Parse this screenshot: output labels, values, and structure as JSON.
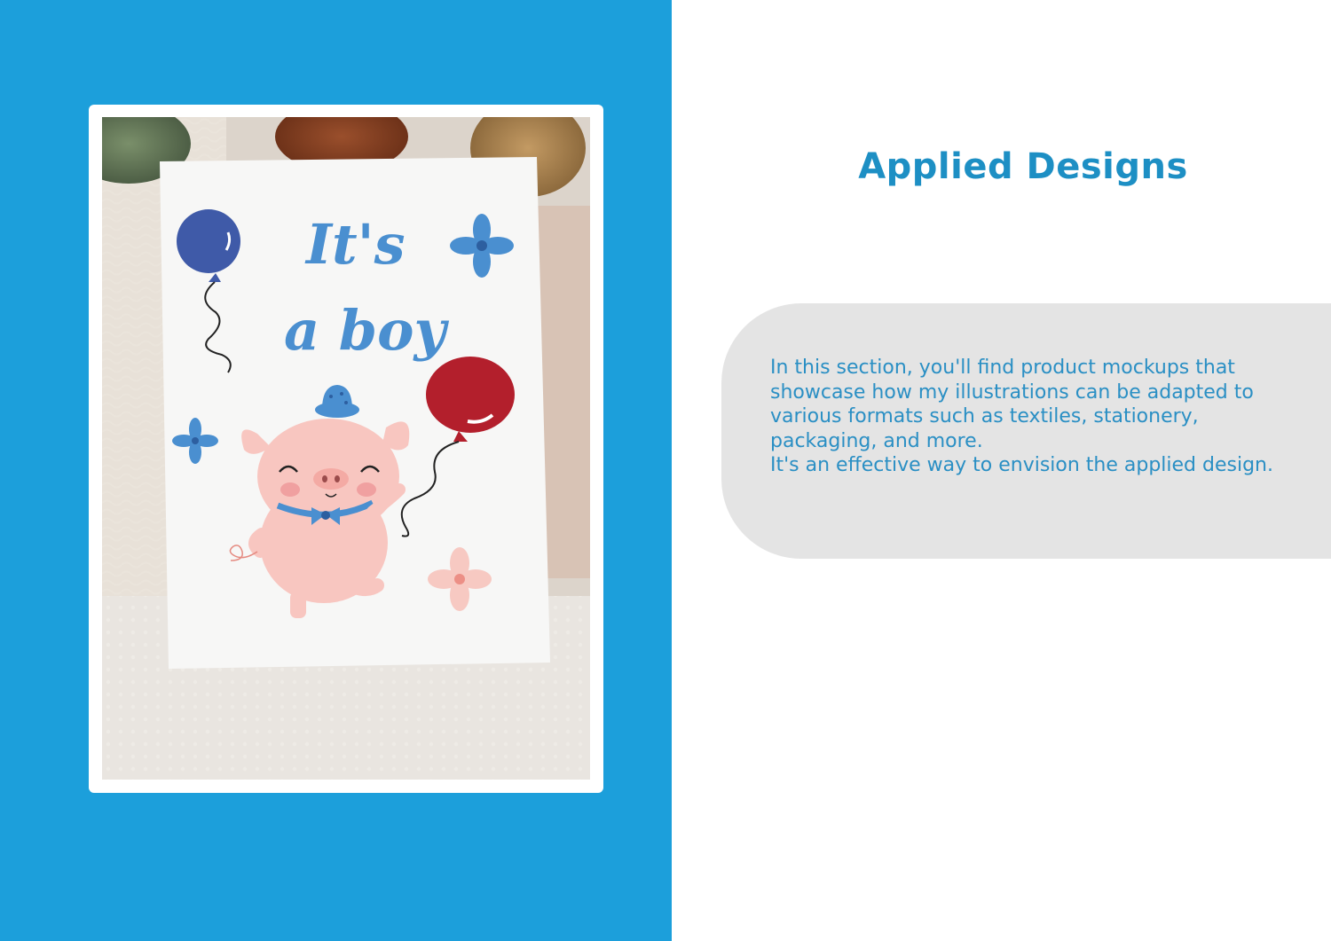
{
  "section": {
    "heading": "Applied Designs",
    "paragraphs": [
      "In this section, you'll find product mockups that showcase how my illustrations can be adapted to various formats such as textiles, stationery, packaging, and more.",
      "It's an effective way to envision the applied design."
    ]
  },
  "mockup": {
    "card_text_line1": "It's",
    "card_text_line2": "a boy"
  },
  "colors": {
    "left_panel": "#1c9fdb",
    "heading": "#1d8fc4",
    "body_text": "#2a8fc4",
    "info_box": "#e4e4e4",
    "card_text": "#4a8fd0",
    "red_balloon": "#b31f2c",
    "blue_balloon": "#3f5aa8",
    "pig": "#f8c6c0"
  }
}
